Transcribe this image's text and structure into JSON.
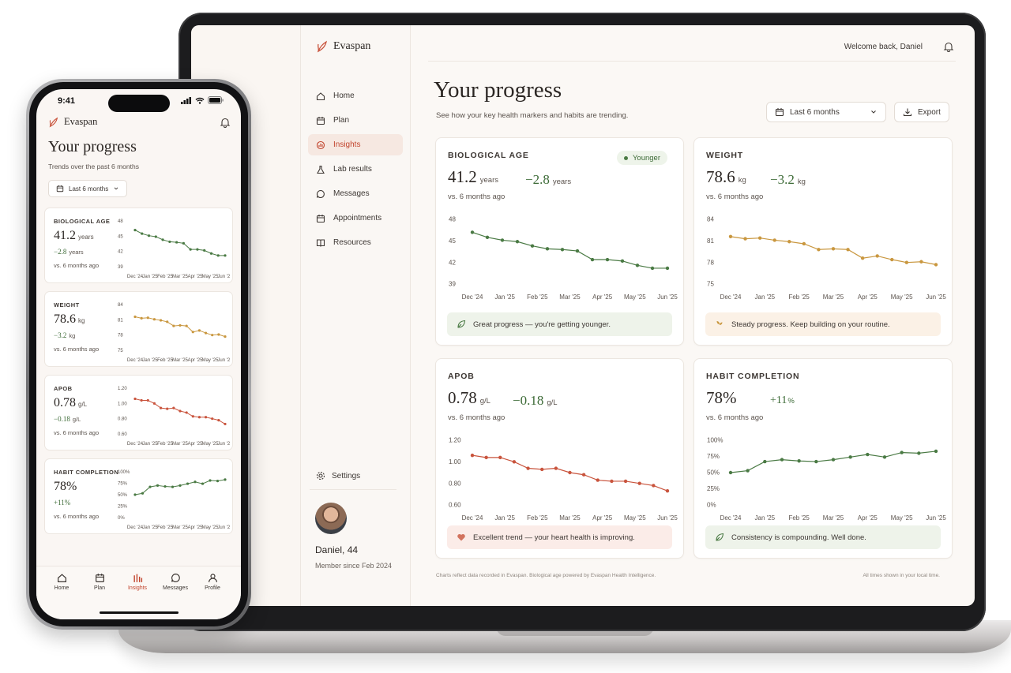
{
  "brand": {
    "name": "Evaspan"
  },
  "desktop": {
    "welcome": "Welcome back, Daniel",
    "nav": [
      {
        "label": "Home",
        "icon": "home-icon"
      },
      {
        "label": "Plan",
        "icon": "calendar-check-icon"
      },
      {
        "label": "Insights",
        "icon": "insights-icon",
        "active": true
      },
      {
        "label": "Lab results",
        "icon": "flask-icon"
      },
      {
        "label": "Messages",
        "icon": "chat-icon"
      },
      {
        "label": "Appointments",
        "icon": "calendar-icon"
      },
      {
        "label": "Resources",
        "icon": "book-icon"
      }
    ],
    "settings_label": "Settings",
    "user": {
      "name": "Daniel, 44",
      "since": "Member since Feb 2024"
    },
    "title": "Your progress",
    "subtitle": "See how your key health markers and habits are trending.",
    "range_label": "Last 6 months",
    "export_label": "Export",
    "footer_left": "Charts reflect data recorded in Evaspan. Biological age powered by Evaspan Health Intelligence.",
    "footer_right": "All times shown in your local time.",
    "cards": {
      "bio": {
        "title": "BIOLOGICAL AGE",
        "value": "41.2",
        "unit": "years",
        "delta": "−2.8",
        "delta_unit": "years",
        "vs": "vs. 6 months ago",
        "chip": "Younger",
        "message": "Great progress — you're getting younger."
      },
      "weight": {
        "title": "WEIGHT",
        "value": "78.6",
        "unit": "kg",
        "delta": "−3.2",
        "delta_unit": "kg",
        "vs": "vs. 6 months ago",
        "message": "Steady progress. Keep building on your routine."
      },
      "apob": {
        "title": "APOB",
        "value": "0.78",
        "unit": "g/L",
        "delta": "−0.18",
        "delta_unit": "g/L",
        "vs": "vs. 6 months ago",
        "message": "Excellent trend — your heart health is improving."
      },
      "habit": {
        "title": "HABIT COMPLETION",
        "value": "78%",
        "unit": "",
        "delta": "+11",
        "delta_unit": "%",
        "vs": "vs. 6 months ago",
        "message": "Consistency is compounding. Well done."
      }
    }
  },
  "phone": {
    "time": "9:41",
    "title": "Your progress",
    "subtitle": "Trends over the past 6 months",
    "range_label": "Last 6 months",
    "cards": {
      "bio": {
        "title": "BIOLOGICAL AGE",
        "value": "41.2",
        "unit": "years",
        "delta": "−2.8",
        "delta_unit": "years",
        "vs": "vs. 6 months ago"
      },
      "weight": {
        "title": "WEIGHT",
        "value": "78.6",
        "unit": "kg",
        "delta": "−3.2",
        "delta_unit": "kg",
        "vs": "vs. 6 months ago"
      },
      "apob": {
        "title": "APOB",
        "value": "0.78",
        "unit": "g/L",
        "delta": "−0.18",
        "delta_unit": "g/L",
        "vs": "vs. 6 months ago"
      },
      "habit": {
        "title": "HABIT COMPLETION",
        "value": "78%",
        "unit": "",
        "delta": "+11%",
        "delta_unit": "",
        "vs": "vs. 6 months ago"
      }
    },
    "tabs": [
      {
        "label": "Home",
        "icon": "home-icon"
      },
      {
        "label": "Plan",
        "icon": "calendar-check-icon"
      },
      {
        "label": "Insights",
        "icon": "insights-icon",
        "active": true
      },
      {
        "label": "Messages",
        "icon": "chat-icon"
      },
      {
        "label": "Profile",
        "icon": "person-icon"
      }
    ]
  },
  "colors": {
    "green": "#4a7a44",
    "amber": "#c9973f",
    "red": "#c9543d",
    "accent": "#c2452e"
  },
  "chart_data": [
    {
      "id": "bio",
      "type": "line",
      "title": "BIOLOGICAL AGE",
      "color": "#4a7a44",
      "x": [
        "Dec '24",
        "Jan '25",
        "Feb '25",
        "Mar '25",
        "Apr '25",
        "May '25",
        "Jun '25"
      ],
      "y_ticks": [
        39,
        42,
        45,
        48
      ],
      "ylim": [
        39,
        48
      ],
      "values": [
        46.2,
        45.5,
        45.1,
        44.9,
        44.3,
        43.9,
        43.8,
        43.6,
        42.4,
        42.4,
        42.2,
        41.6,
        41.2,
        41.2
      ]
    },
    {
      "id": "weight",
      "type": "line",
      "title": "WEIGHT",
      "color": "#c9973f",
      "x": [
        "Dec '24",
        "Jan '25",
        "Feb '25",
        "Mar '25",
        "Apr '25",
        "May '25",
        "Jun '25"
      ],
      "y_ticks": [
        75,
        78,
        81,
        84
      ],
      "ylim": [
        75,
        84
      ],
      "values": [
        81.6,
        81.3,
        81.4,
        81.1,
        80.9,
        80.6,
        79.8,
        79.9,
        79.8,
        78.6,
        78.9,
        78.4,
        78.0,
        78.1,
        77.7
      ]
    },
    {
      "id": "apob",
      "type": "line",
      "title": "APOB",
      "color": "#c9543d",
      "x": [
        "Dec '24",
        "Jan '25",
        "Feb '25",
        "Mar '25",
        "Apr '25",
        "May '25",
        "Jun '25"
      ],
      "y_ticks": [
        "0.60",
        "0.80",
        "1.00",
        "1.20"
      ],
      "ylim": [
        0.6,
        1.2
      ],
      "values": [
        1.06,
        1.04,
        1.04,
        1.0,
        0.94,
        0.93,
        0.94,
        0.9,
        0.88,
        0.83,
        0.82,
        0.82,
        0.8,
        0.78,
        0.73
      ]
    },
    {
      "id": "habit",
      "type": "line",
      "title": "HABIT COMPLETION",
      "color": "#4a7a44",
      "x": [
        "Dec '24",
        "Jan '25",
        "Feb '25",
        "Mar '25",
        "Apr '25",
        "May '25",
        "Jun '25"
      ],
      "y_ticks": [
        "0%",
        "25%",
        "50%",
        "75%",
        "100%"
      ],
      "ylim": [
        0,
        100
      ],
      "values": [
        50,
        53,
        67,
        70,
        68,
        67,
        70,
        74,
        78,
        74,
        81,
        80,
        83
      ]
    }
  ]
}
